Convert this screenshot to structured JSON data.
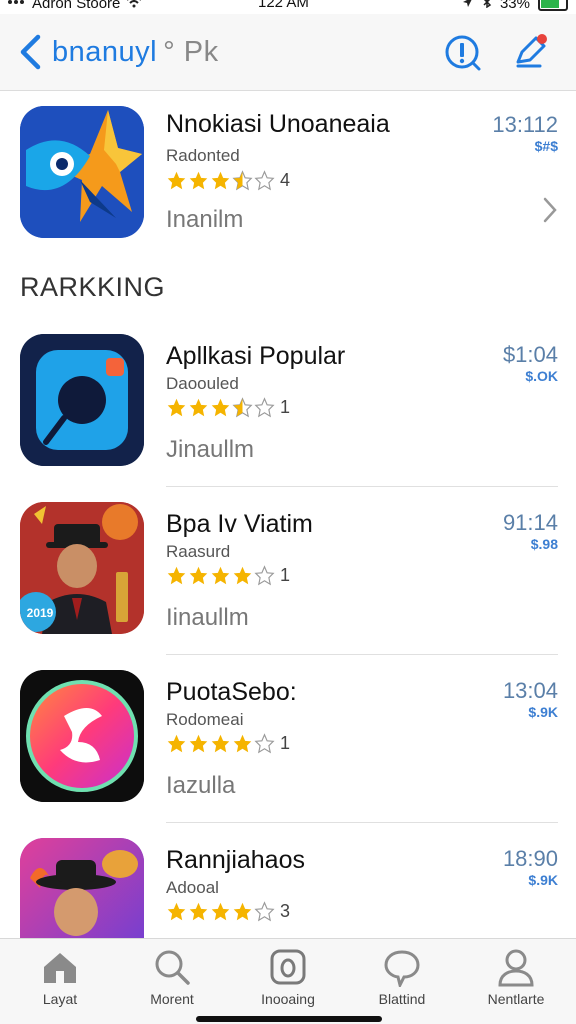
{
  "status_bar": {
    "carrier": "Adron Stoore",
    "time": "122 AM",
    "battery": "33%"
  },
  "nav": {
    "title": "bnanuyl",
    "title_suffix": "° Pk",
    "icons": [
      "back-chevron-icon",
      "info-icon",
      "compose-icon"
    ]
  },
  "featured": {
    "name": "Nnokiasi Unoaneaia",
    "subtitle": "Radonted",
    "rating_count": "4",
    "action": "Inanilm",
    "price": "13:112",
    "size": "$#$"
  },
  "section": {
    "title": "RARKKING"
  },
  "apps": [
    {
      "name": "Apllkasi Popular",
      "subtitle": "Daoouled",
      "rating_count": "1",
      "action": "Jinaullm",
      "price": "$1:04",
      "size": "$.OK"
    },
    {
      "name": "Bpa Iv Viatim",
      "subtitle": "Raasurd",
      "rating_count": "1",
      "action": "Iinaullm",
      "price": "91:14",
      "size": "$.98",
      "icon_badge": "2019"
    },
    {
      "name": "PuotaSebo:",
      "subtitle": "Rodomeai",
      "rating_count": "1",
      "action": "Iazulla",
      "price": "13:04",
      "size": "$.9K"
    },
    {
      "name": "Rannjiahaos",
      "subtitle": "Adooal",
      "rating_count": "3",
      "price": "18:90",
      "size": "$.9K"
    }
  ],
  "tabs": [
    {
      "label": "Layat",
      "icon": "home-icon"
    },
    {
      "label": "Morent",
      "icon": "search-icon"
    },
    {
      "label": "Inooaing",
      "icon": "camera-icon"
    },
    {
      "label": "Blattind",
      "icon": "chat-bubble-icon"
    },
    {
      "label": "Nentlarte",
      "icon": "person-icon"
    }
  ],
  "colors": {
    "accent": "#1f7be0",
    "star": "#f5b400",
    "price": "#5a7fa8"
  }
}
